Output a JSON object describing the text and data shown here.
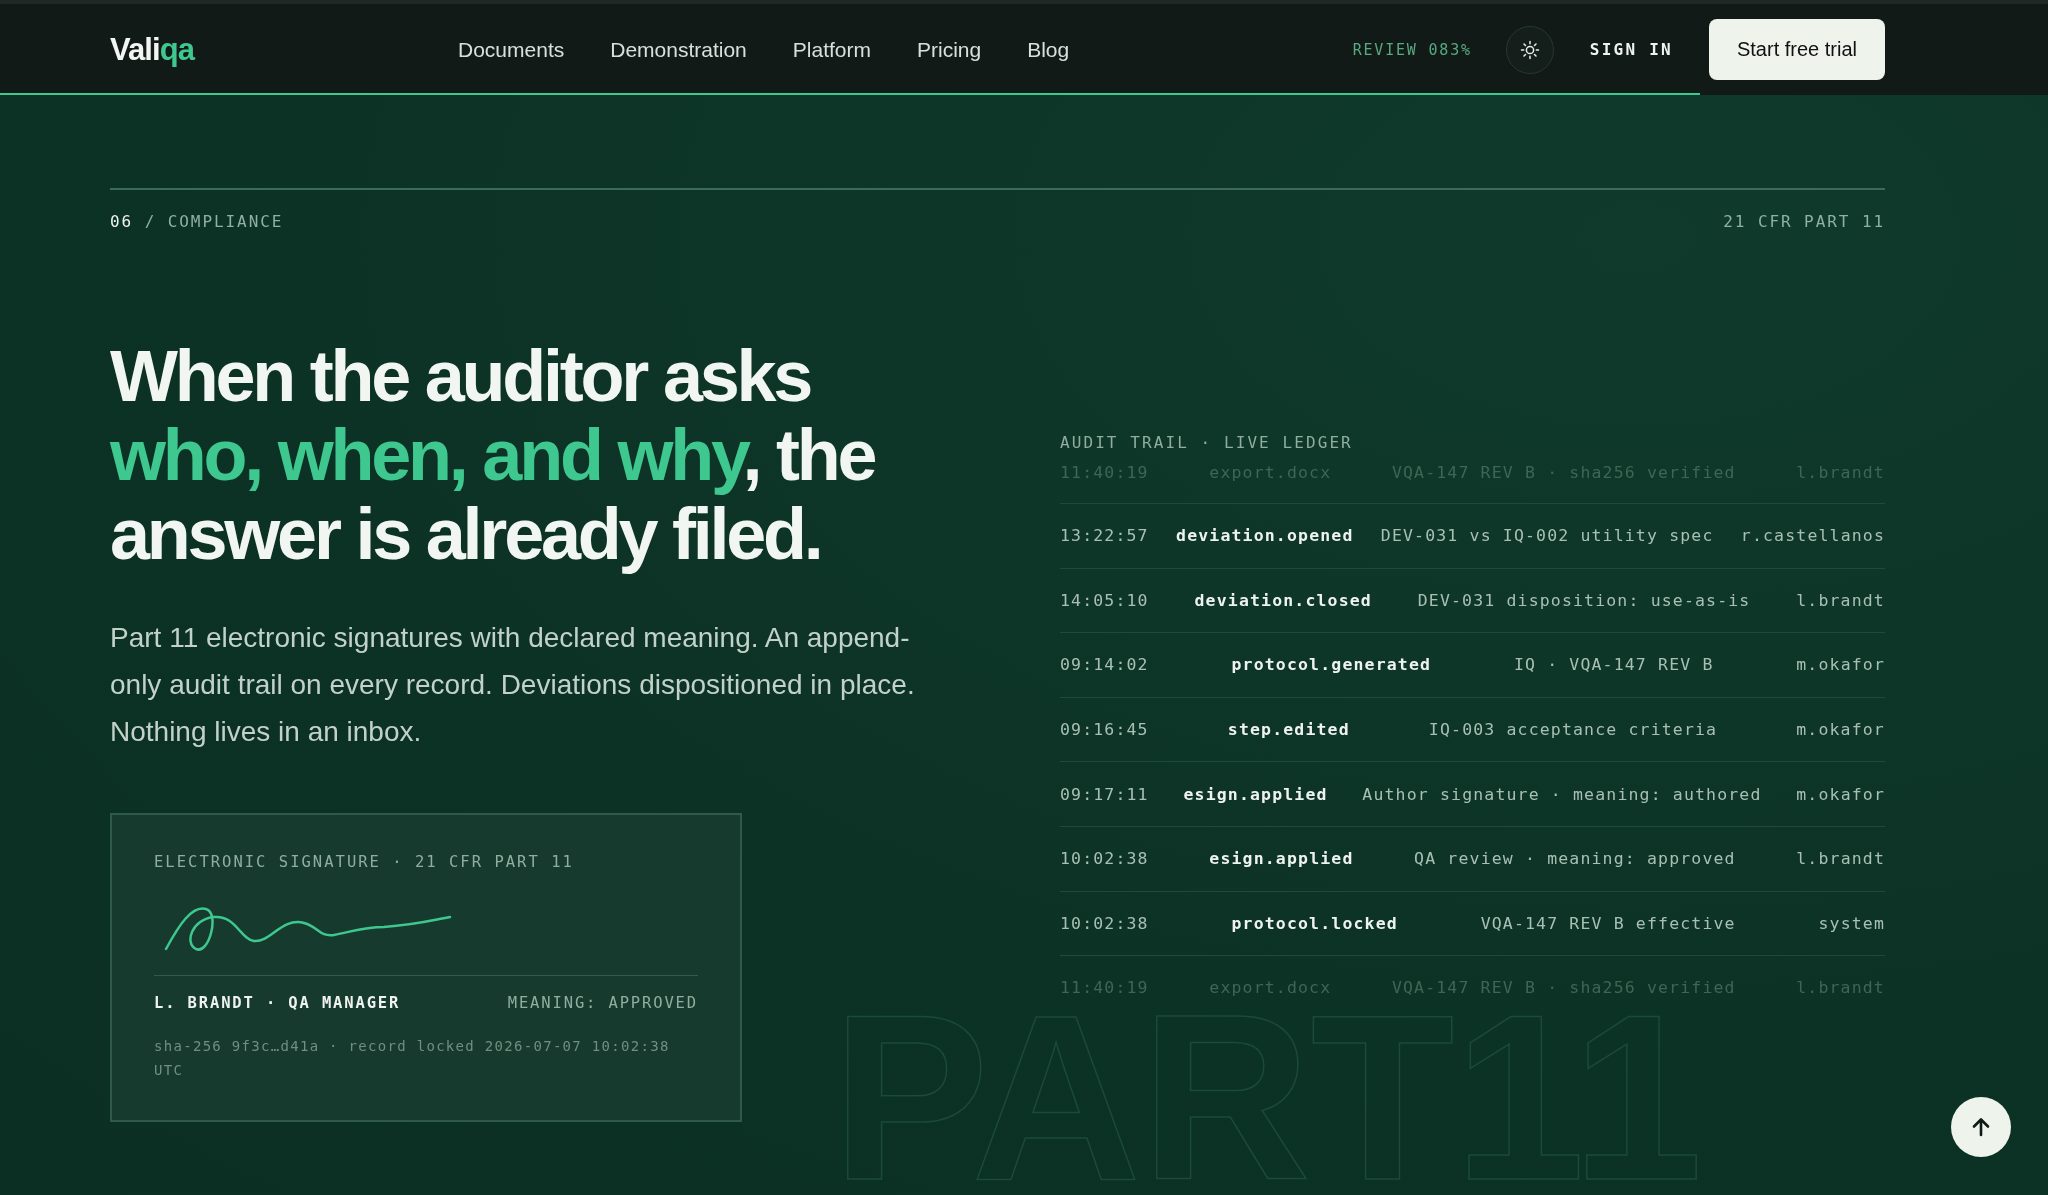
{
  "nav": {
    "brand": {
      "main": "Vali",
      "accent": "qa"
    },
    "links": [
      "Documents",
      "Demonstration",
      "Platform",
      "Pricing",
      "Blog"
    ],
    "review": "REVIEW 083%",
    "progress": {
      "level": 0.83
    },
    "sign_in": "SIGN IN",
    "cta": "Start free trial"
  },
  "section": {
    "number": "06",
    "separator": "/",
    "name": "COMPLIANCE",
    "reference": "21 CFR PART 11"
  },
  "hero": {
    "heading": [
      {
        "text": "When the auditor asks ",
        "accent": false
      },
      {
        "text": "who, when, and why",
        "accent": true
      },
      {
        "text": ", the answer is already filed.",
        "accent": false
      }
    ],
    "body": "Part 11 electronic signatures with declared meaning. An append-only audit trail on every record. Deviations dispositioned in place. Nothing lives in an inbox."
  },
  "signature_card": {
    "title": "ELECTRONIC SIGNATURE · 21 CFR PART 11",
    "signer": "L. BRANDT · QA MANAGER",
    "meaning": "MEANING: APPROVED",
    "hash": "sha-256 9f3c…d41a · record locked 2026-07-07 10:02:38 UTC"
  },
  "audit_trail": {
    "title": "AUDIT TRAIL · LIVE LEDGER",
    "rows": [
      {
        "time": "11:40:19",
        "event": "export.docx",
        "detail": "VQA-147 REV B · sha256 verified",
        "user": "l.brandt",
        "faded": true
      },
      {
        "time": "13:22:57",
        "event": "deviation.opened",
        "detail": "DEV-031 vs IQ-002 utility spec",
        "user": "r.castellanos",
        "faded": false
      },
      {
        "time": "14:05:10",
        "event": "deviation.closed",
        "detail": "DEV-031 disposition: use-as-is",
        "user": "l.brandt",
        "faded": false
      },
      {
        "time": "09:14:02",
        "event": "protocol.generated",
        "detail": "IQ · VQA-147 REV B",
        "user": "m.okafor",
        "faded": false
      },
      {
        "time": "09:16:45",
        "event": "step.edited",
        "detail": "IQ-003 acceptance criteria",
        "user": "m.okafor",
        "faded": false
      },
      {
        "time": "09:17:11",
        "event": "esign.applied",
        "detail": "Author signature · meaning: authored",
        "user": "m.okafor",
        "faded": false
      },
      {
        "time": "10:02:38",
        "event": "esign.applied",
        "detail": "QA review · meaning: approved",
        "user": "l.brandt",
        "faded": false
      },
      {
        "time": "10:02:38",
        "event": "protocol.locked",
        "detail": "VQA-147 REV B effective",
        "user": "system",
        "faded": false
      },
      {
        "time": "11:40:19",
        "event": "export.docx",
        "detail": "VQA-147 REV B · sha256 verified",
        "user": "l.brandt",
        "faded": true
      }
    ]
  },
  "backdrop_text": "PART11"
}
